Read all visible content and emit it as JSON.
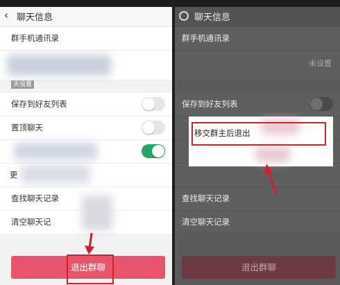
{
  "left": {
    "title": "聊天信息",
    "group_contacts_label": "群手机通讯录",
    "section_tag": "天设置",
    "save_to_contacts_label": "保存到好友列表",
    "pin_chat_label": "置顶聊天",
    "partial_row_char": "更",
    "search_history_label": "查找聊天记录",
    "clear_history_label": "清空聊天记",
    "exit_button_label": "退出群聊",
    "toggles": {
      "save_to_contacts": false,
      "pin_chat": false,
      "third_row": true
    }
  },
  "right": {
    "title": "聊天信息",
    "group_contacts_label": "群手机通讯录",
    "not_set_label": "未设置",
    "save_to_contacts_label": "保存到好友列表",
    "popup_option_label": "移交群主后退出",
    "search_history_label": "查找聊天记录",
    "clear_history_label": "清空聊天记录",
    "exit_button_label": "退出群聊"
  },
  "colors": {
    "accent_red": "#e8546b",
    "toggle_green": "#23a56b",
    "highlight_red": "#d0202a"
  }
}
